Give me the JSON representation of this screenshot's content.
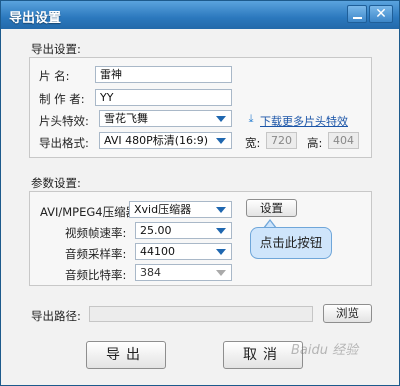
{
  "window": {
    "title": "导出设置"
  },
  "export_settings": {
    "section_label": "导出设置:",
    "name_label": "片    名:",
    "name_value": "雷神",
    "author_label": "制 作 者:",
    "author_value": "YY",
    "intro_effect_label": "片头特效:",
    "intro_effect_value": "雪花飞舞",
    "download_link": "下载更多片头特效",
    "format_label": "导出格式:",
    "format_value": "AVI 480P标清(16:9)",
    "width_label": "宽:",
    "width_value": "720",
    "height_label": "高:",
    "height_value": "404"
  },
  "params": {
    "section_label": "参数设置:",
    "encoder_label": "AVI/MPEG4压缩器:",
    "encoder_value": "Xvid压缩器",
    "settings_button": "设置",
    "callout": "点击此按钮",
    "framerate_label": "视频帧速率:",
    "framerate_value": "25.00",
    "samplerate_label": "音频采样率:",
    "samplerate_value": "44100",
    "bitrate_label": "音频比特率:",
    "bitrate_value": "384"
  },
  "path": {
    "label": "导出路径:",
    "value": "",
    "browse_button": "浏览"
  },
  "footer": {
    "export_button": "导出",
    "cancel_button": "取消"
  },
  "watermark": "Baidu 经验"
}
